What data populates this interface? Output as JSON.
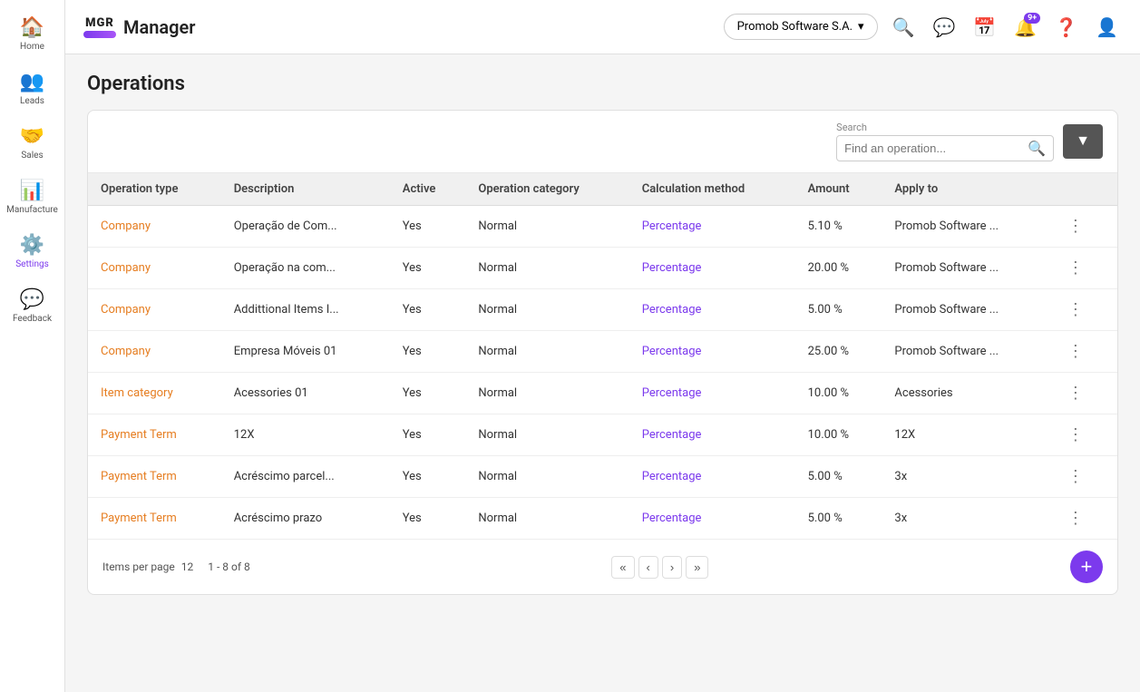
{
  "app": {
    "logo_text": "MGR",
    "app_name": "Manager",
    "company": "Promob Software S.A.",
    "notification_badge": "9+"
  },
  "sidebar": {
    "items": [
      {
        "id": "home",
        "label": "Home",
        "icon": "🏠",
        "active": false
      },
      {
        "id": "leads",
        "label": "Leads",
        "icon": "👥",
        "active": false
      },
      {
        "id": "sales",
        "label": "Sales",
        "icon": "🤝",
        "active": false
      },
      {
        "id": "manufacture",
        "label": "Manufacture",
        "icon": "📊",
        "active": false
      },
      {
        "id": "settings",
        "label": "Settings",
        "icon": "⚙️",
        "active": true
      },
      {
        "id": "feedback",
        "label": "Feedback",
        "icon": "💬",
        "active": false
      }
    ]
  },
  "page": {
    "title": "Operations"
  },
  "search": {
    "label": "Search",
    "placeholder": "Find an operation..."
  },
  "table": {
    "columns": [
      "Operation type",
      "Description",
      "Active",
      "Operation category",
      "Calculation method",
      "Amount",
      "Apply to"
    ],
    "rows": [
      {
        "operation_type": "Company",
        "description": "Operação de Com...",
        "active": "Yes",
        "category": "Normal",
        "method": "Percentage",
        "amount": "5.10 %",
        "apply_to": "Promob Software ..."
      },
      {
        "operation_type": "Company",
        "description": "Operação na com...",
        "active": "Yes",
        "category": "Normal",
        "method": "Percentage",
        "amount": "20.00 %",
        "apply_to": "Promob Software ..."
      },
      {
        "operation_type": "Company",
        "description": "Addittional Items I...",
        "active": "Yes",
        "category": "Normal",
        "method": "Percentage",
        "amount": "5.00 %",
        "apply_to": "Promob Software ..."
      },
      {
        "operation_type": "Company",
        "description": "Empresa Móveis 01",
        "active": "Yes",
        "category": "Normal",
        "method": "Percentage",
        "amount": "25.00 %",
        "apply_to": "Promob Software ..."
      },
      {
        "operation_type": "Item category",
        "description": "Acessories 01",
        "active": "Yes",
        "category": "Normal",
        "method": "Percentage",
        "amount": "10.00 %",
        "apply_to": "Acessories"
      },
      {
        "operation_type": "Payment Term",
        "description": "12X",
        "active": "Yes",
        "category": "Normal",
        "method": "Percentage",
        "amount": "10.00 %",
        "apply_to": "12X"
      },
      {
        "operation_type": "Payment Term",
        "description": "Acréscimo parcel...",
        "active": "Yes",
        "category": "Normal",
        "method": "Percentage",
        "amount": "5.00 %",
        "apply_to": "3x"
      },
      {
        "operation_type": "Payment Term",
        "description": "Acréscimo prazo",
        "active": "Yes",
        "category": "Normal",
        "method": "Percentage",
        "amount": "5.00 %",
        "apply_to": "3x"
      }
    ]
  },
  "pagination": {
    "items_per_page_label": "Items per page",
    "items_per_page": "12",
    "range": "1 - 8 of 8"
  },
  "buttons": {
    "filter": "▼",
    "add": "+",
    "more": "⋮",
    "first_page": "«",
    "prev_page": "‹",
    "next_page": "›",
    "last_page": "»"
  }
}
